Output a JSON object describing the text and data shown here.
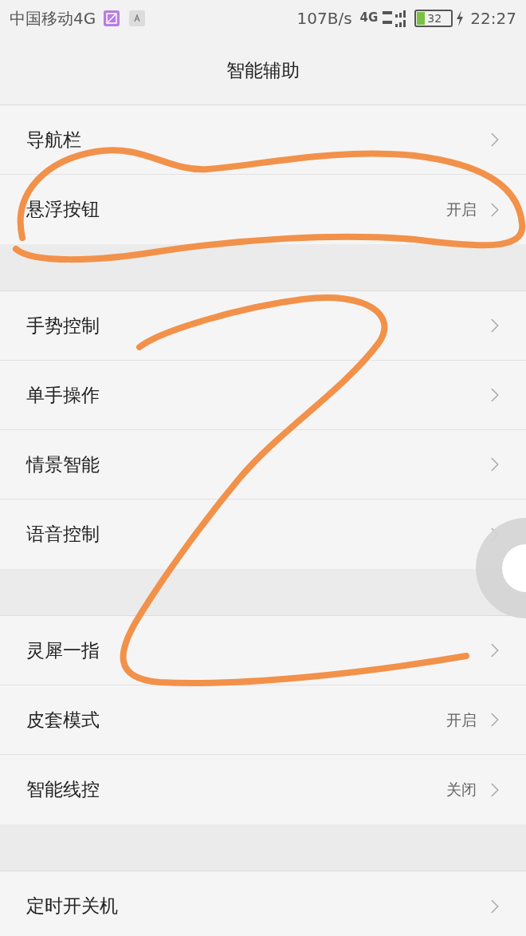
{
  "status_bar": {
    "carrier": "中国移动4G",
    "net_speed": "107B/s",
    "network": "4G",
    "battery": "32",
    "charging": true,
    "time": "22:27"
  },
  "title": "智能辅助",
  "groups": [
    {
      "items": [
        {
          "label": "导航栏"
        },
        {
          "label": "悬浮按钮",
          "value": "开启"
        }
      ]
    },
    {
      "items": [
        {
          "label": "手势控制"
        },
        {
          "label": "单手操作"
        },
        {
          "label": "情景智能"
        },
        {
          "label": "语音控制"
        }
      ]
    },
    {
      "items": [
        {
          "label": "灵犀一指"
        },
        {
          "label": "皮套模式",
          "value": "开启"
        },
        {
          "label": "智能线控",
          "value": "关闭"
        }
      ]
    },
    {
      "items": [
        {
          "label": "定时开关机"
        }
      ]
    }
  ]
}
